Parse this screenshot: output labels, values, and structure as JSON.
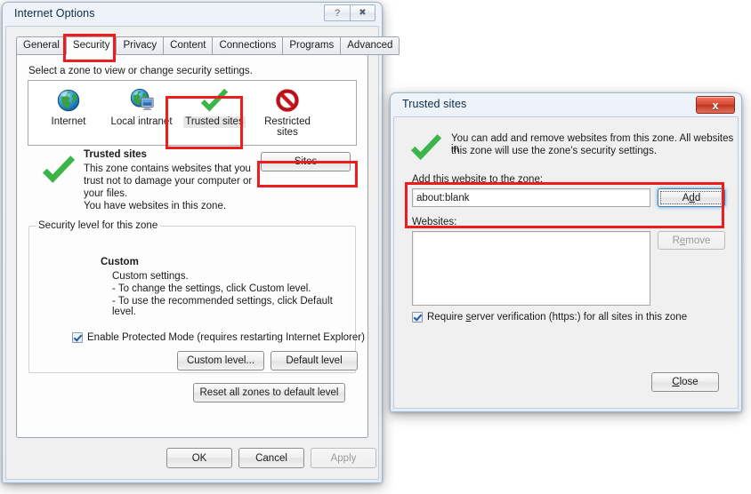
{
  "internet_options": {
    "title": "Internet Options",
    "caption_buttons": [
      {
        "name": "help-button",
        "glyph": "?"
      },
      {
        "name": "close-button",
        "glyph": "✖"
      }
    ],
    "tabs": [
      {
        "label": "General",
        "active": false
      },
      {
        "label": "Security",
        "active": true
      },
      {
        "label": "Privacy",
        "active": false
      },
      {
        "label": "Content",
        "active": false
      },
      {
        "label": "Connections",
        "active": false
      },
      {
        "label": "Programs",
        "active": false
      },
      {
        "label": "Advanced",
        "active": false
      }
    ],
    "zone_prompt": "Select a zone to view or change security settings.",
    "zones": [
      {
        "label": "Internet",
        "icon": "globe-icon",
        "selected": false
      },
      {
        "label": "Local intranet",
        "icon": "globe-monitor-icon",
        "selected": false
      },
      {
        "label": "Trusted sites",
        "icon": "green-check-icon",
        "selected": true
      },
      {
        "label": "Restricted sites",
        "icon": "prohibition-icon",
        "selected": false
      }
    ],
    "zone_detail": {
      "heading": "Trusted sites",
      "icon": "green-check-icon",
      "lines": [
        "This zone contains websites that you",
        "trust not to damage your computer or",
        "your files.",
        "You have websites in this zone."
      ],
      "sites_button": "Sites"
    },
    "security_level": {
      "group_label": "Security level for this zone",
      "level_name": "Custom",
      "lines": [
        "Custom settings.",
        "- To change the settings, click Custom level.",
        "- To use the recommended settings, click Default level."
      ],
      "protected_mode": {
        "label": "Enable Protected Mode (requires restarting Internet Explorer)",
        "checked": true
      },
      "custom_level_button": "Custom level...",
      "default_level_button": "Default level"
    },
    "reset_button": "Reset all zones to default level",
    "footer_buttons": [
      {
        "label": "OK",
        "enabled": true
      },
      {
        "label": "Cancel",
        "enabled": true
      },
      {
        "label": "Apply",
        "enabled": false
      }
    ]
  },
  "trusted_sites": {
    "title": "Trusted sites",
    "close_button_glyph": "x",
    "header_icon": "green-check-icon",
    "header_lines": [
      "You can add and remove websites from this zone. All websites in",
      "this zone will use the zone's security settings."
    ],
    "add_label_pre": "A",
    "add_label_accel": "d",
    "add_label_post": "d this website to the zone:",
    "add_input_value": "about:blank",
    "add_button_pre": "A",
    "add_button_accel": "d",
    "add_button_post": "d",
    "websites_label_accel": "W",
    "websites_label_post": "ebsites:",
    "websites_items": [],
    "remove_button_pre": "R",
    "remove_button_accel": "e",
    "remove_button_post": "move",
    "remove_enabled": false,
    "require_verification": {
      "pre": "Require ",
      "accel": "s",
      "post": "erver verification (https:) for all sites in this zone",
      "checked": true
    },
    "close_label_pre": "",
    "close_label_accel": "C",
    "close_label_post": "lose"
  },
  "annotations": {
    "color": "#ee1c1c",
    "boxes": [
      {
        "name": "annotation-security-tab"
      },
      {
        "name": "annotation-trusted-sites-zone"
      },
      {
        "name": "annotation-sites-button"
      },
      {
        "name": "annotation-add-website-row"
      }
    ]
  }
}
